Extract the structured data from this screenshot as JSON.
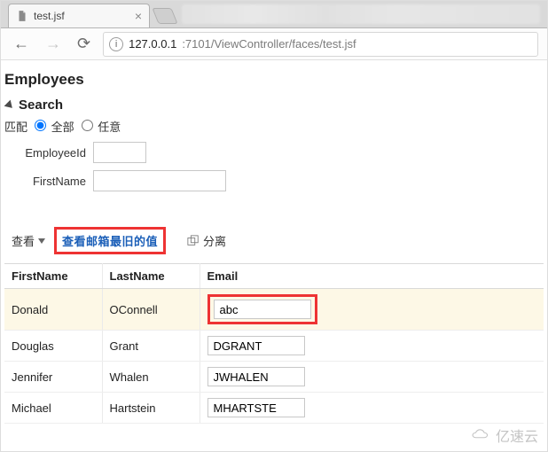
{
  "browser": {
    "tab_title": "test.jsf",
    "url_host": "127.0.0.1",
    "url_path": ":7101/ViewController/faces/test.jsf"
  },
  "page": {
    "title": "Employees",
    "search": {
      "label": "Search",
      "match_label": "匹配",
      "all_label": "全部",
      "any_label": "任意",
      "match_value": "all",
      "fields": {
        "employee_id": {
          "label": "EmployeeId",
          "value": ""
        },
        "first_name": {
          "label": "FirstName",
          "value": ""
        }
      }
    },
    "toolbar": {
      "view_label": "查看",
      "highlighted_button": "查看邮箱最旧的值",
      "detach_label": "分离"
    },
    "table": {
      "columns": {
        "first_name": "FirstName",
        "last_name": "LastName",
        "email": "Email"
      },
      "rows": [
        {
          "first_name": "Donald",
          "last_name": "OConnell",
          "email": "abc",
          "selected": true,
          "highlight_email": true
        },
        {
          "first_name": "Douglas",
          "last_name": "Grant",
          "email": "DGRANT",
          "selected": false,
          "highlight_email": false
        },
        {
          "first_name": "Jennifer",
          "last_name": "Whalen",
          "email": "JWHALEN",
          "selected": false,
          "highlight_email": false
        },
        {
          "first_name": "Michael",
          "last_name": "Hartstein",
          "email": "MHARTSTE",
          "selected": false,
          "highlight_email": false
        }
      ]
    }
  },
  "watermark": "亿速云"
}
